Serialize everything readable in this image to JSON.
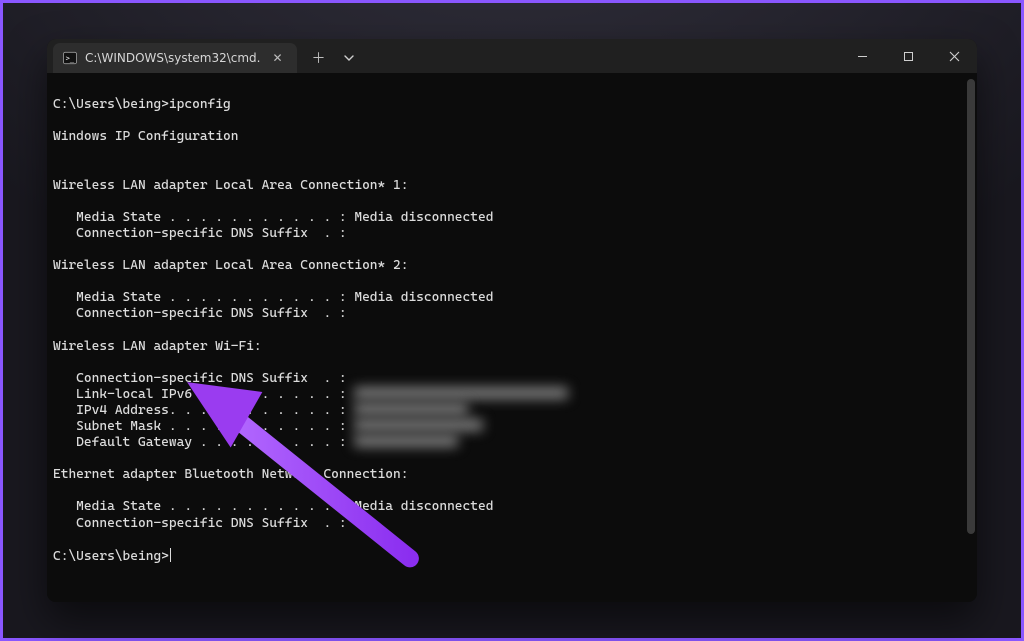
{
  "titlebar": {
    "tab_label": "C:\\WINDOWS\\system32\\cmd.",
    "icons": {
      "cmd": "cmd-icon",
      "close": "close-icon",
      "new_tab": "plus-icon",
      "dropdown": "chevron-down-icon"
    }
  },
  "window_controls": {
    "minimize": "minimize-icon",
    "maximize": "maximize-icon",
    "close": "close-icon"
  },
  "terminal": {
    "prompt1": "C:\\Users\\being>",
    "command": "ipconfig",
    "header": "Windows IP Configuration",
    "adapters": [
      {
        "title": "Wireless LAN adapter Local Area Connection* 1:",
        "lines": [
          "   Media State . . . . . . . . . . . : Media disconnected",
          "   Connection-specific DNS Suffix  . :"
        ]
      },
      {
        "title": "Wireless LAN adapter Local Area Connection* 2:",
        "lines": [
          "   Media State . . . . . . . . . . . : Media disconnected",
          "   Connection-specific DNS Suffix  . :"
        ]
      },
      {
        "title": "Wireless LAN adapter Wi-Fi:",
        "lines": [
          "   Connection-specific DNS Suffix  . :",
          "   Link-local IPv6 Address . . . . . :",
          "   IPv4 Address. . . . . . . . . . . :",
          "   Subnet Mask . . . . . . . . . . . :",
          "   Default Gateway . . . . . . . . . :"
        ],
        "has_blurred_values": true
      },
      {
        "title": "Ethernet adapter Bluetooth Network Connection:",
        "lines": [
          "   Media State . . . . . . . . . . . : Media disconnected",
          "   Connection-specific DNS Suffix  . :"
        ]
      }
    ],
    "prompt2": "C:\\Users\\being>"
  },
  "annotation": {
    "arrow_color": "#9a3cf0",
    "points_to": "IPv4 Address"
  }
}
